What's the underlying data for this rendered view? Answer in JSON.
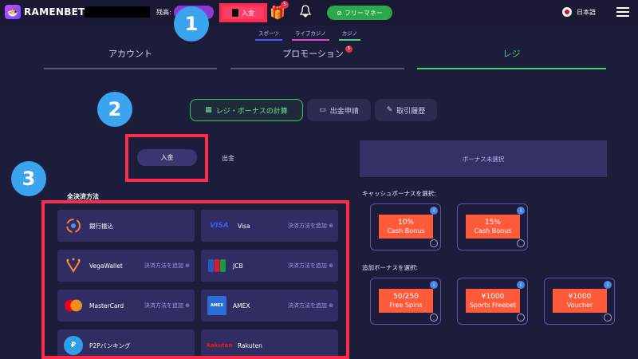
{
  "header": {
    "brand": "RAMENBET",
    "balance_label": "残高:",
    "deposit_label": "入金",
    "gift_badge": "5",
    "free_money_label": "フリーマネー",
    "language": "日本語"
  },
  "subnav": {
    "items": [
      "スポーツ",
      "ライブカジノ",
      "カジノ"
    ]
  },
  "tabs": [
    {
      "label": "アカウント"
    },
    {
      "label": "プロモーション",
      "badge": "5"
    },
    {
      "label": "レジ"
    }
  ],
  "sections": {
    "calc": "レジ・ボーナスの計算",
    "withdraw_request": "出金申請",
    "history": "取引履歴"
  },
  "toggle": {
    "deposit": "入金",
    "withdraw": "出金"
  },
  "methods_title": "全決済方法",
  "add_method_label": "決済方法を追加",
  "methods": [
    {
      "name": "銀行振込",
      "icon": "bank-transfer-icon"
    },
    {
      "name": "Visa",
      "icon": "visa-icon",
      "logo": "VISA"
    },
    {
      "name": "VegaWallet",
      "icon": "vegawallet-icon"
    },
    {
      "name": "JCB",
      "icon": "jcb-icon",
      "logo": "JCB"
    },
    {
      "name": "MasterCard",
      "icon": "mastercard-icon"
    },
    {
      "name": "AMEX",
      "icon": "amex-icon",
      "logo": "AMEX"
    },
    {
      "name": "P2Pバンキング",
      "icon": "p2p-icon"
    },
    {
      "name": "Rakuten",
      "icon": "rakuten-icon",
      "logo": "Rakuten"
    }
  ],
  "bonus": {
    "status": "ボーナス未選択",
    "cash_label": "キャッシュボーナスを選択:",
    "extra_label": "追加ボーナスを選択:",
    "cash": [
      {
        "big": "10%",
        "small": "Cash Bonus"
      },
      {
        "big": "15%",
        "small": "Cash Bonus"
      }
    ],
    "extra": [
      {
        "big": "50/250",
        "small": "Free Spins"
      },
      {
        "big": "¥1000",
        "small": "Sports Freebet"
      },
      {
        "big": "¥1000",
        "small": "Voucher"
      }
    ]
  },
  "callouts": [
    "1",
    "2",
    "3"
  ],
  "colors": {
    "accent_green": "#40d46a",
    "deposit_red": "#ff3d6a",
    "callout_blue": "#3aa4ef"
  }
}
